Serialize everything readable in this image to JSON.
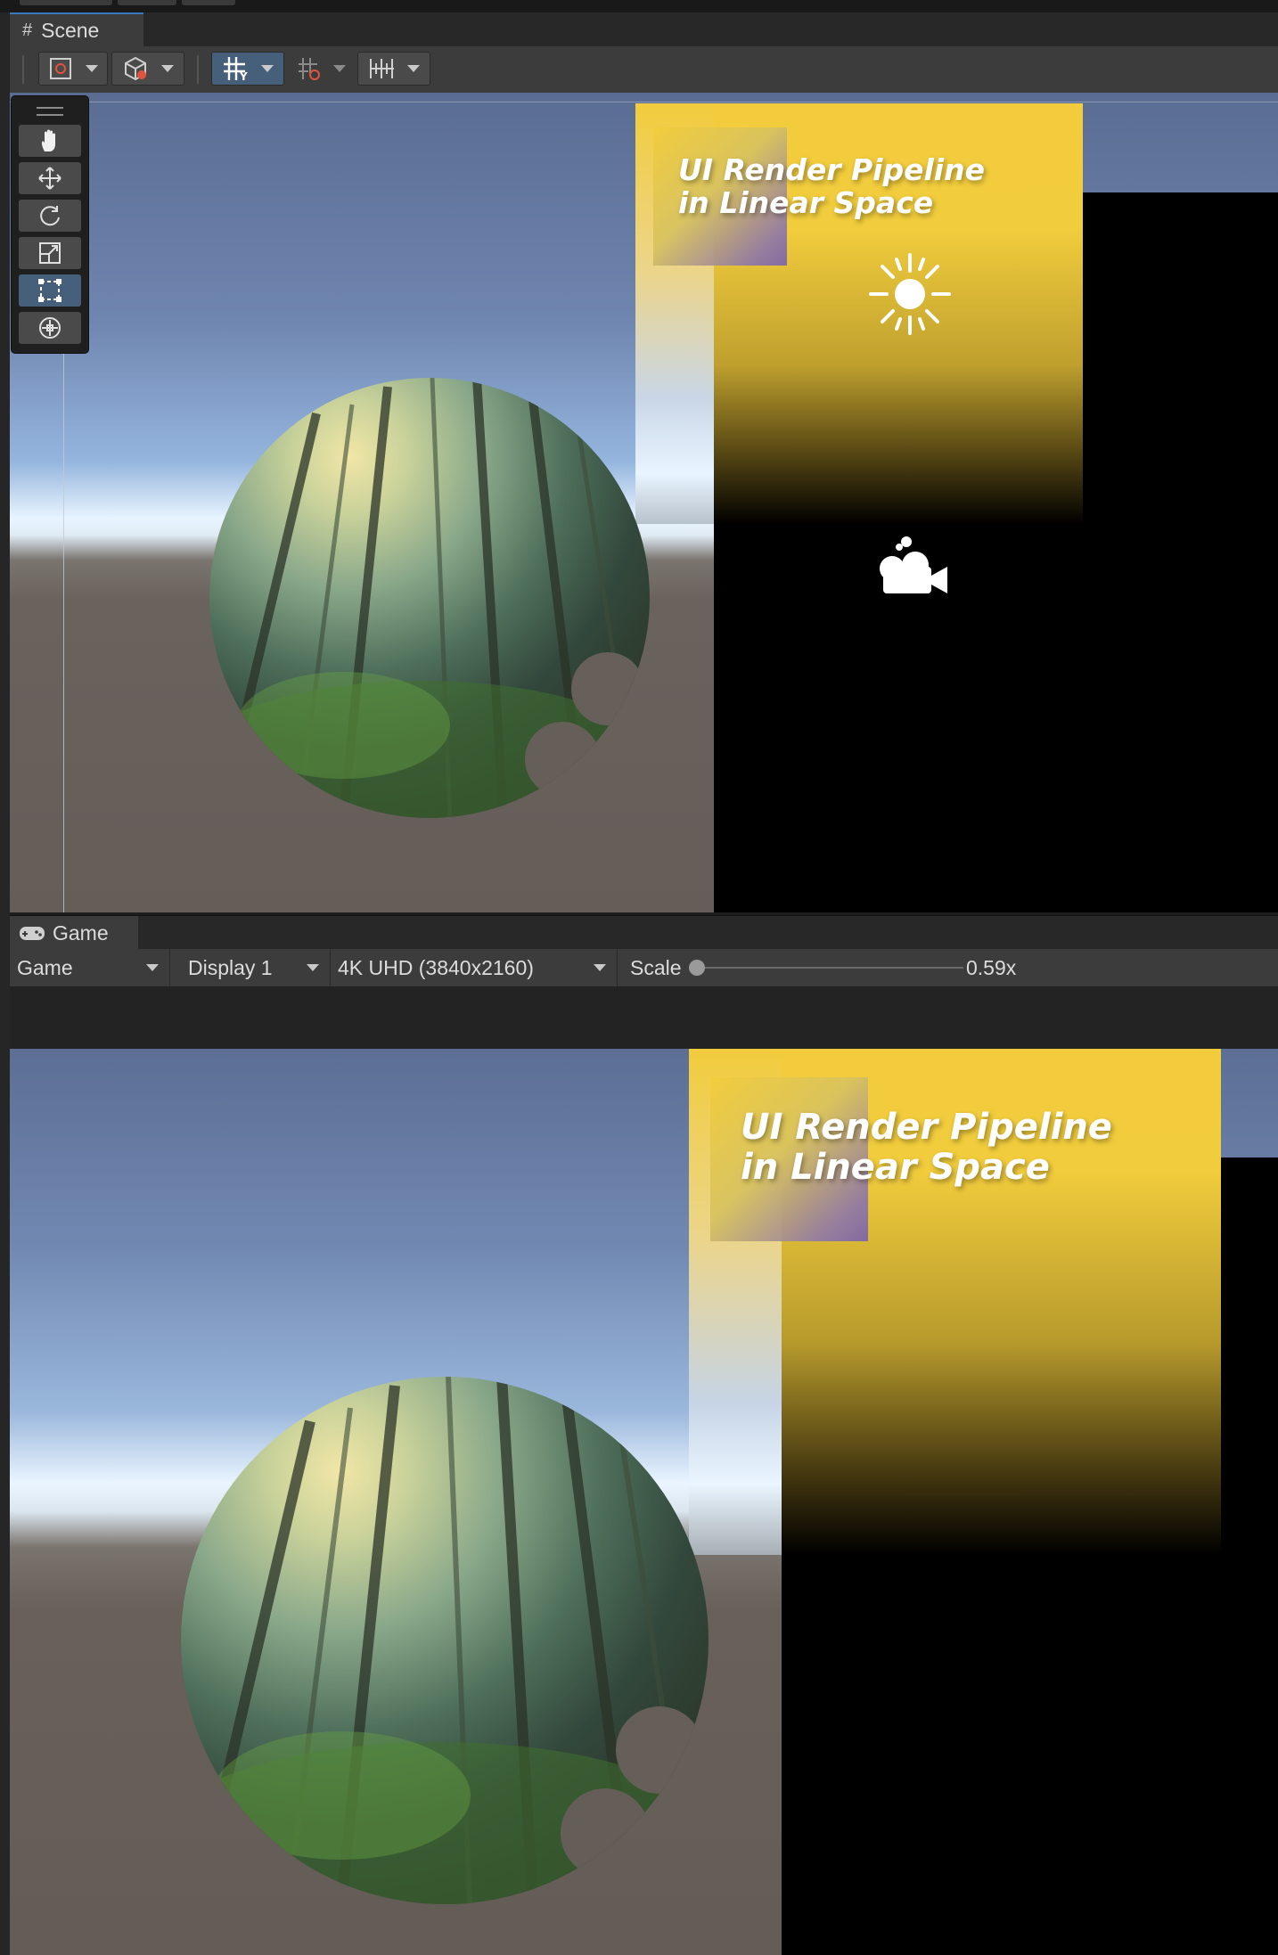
{
  "scene": {
    "tab_label": "Scene",
    "title_line1": "UI Render Pipeline",
    "title_line2": "in Linear Space",
    "tools": [
      "hand-icon",
      "move-icon",
      "rotate-icon",
      "scale-icon",
      "rect-transform-icon",
      "transform-icon"
    ],
    "active_tool": "rect-transform-icon"
  },
  "game": {
    "tab_label": "Game",
    "mode_label": "Game",
    "display_label": "Display 1",
    "resolution_label": "4K UHD (3840x2160)",
    "scale_label": "Scale",
    "scale_value": "0.59x",
    "title_line1": "UI Render Pipeline",
    "title_line2": "in Linear Space"
  },
  "colors": {
    "accent": "#3a79bb",
    "canvas_yellow": "#f2cc3c",
    "active_tool": "#46607c"
  }
}
